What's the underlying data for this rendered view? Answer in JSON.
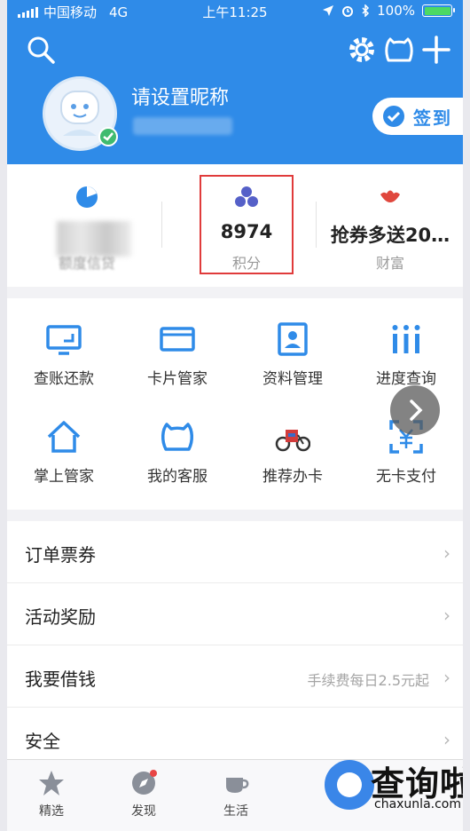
{
  "status_bar": {
    "carrier": "中国移动",
    "network": "4G",
    "time": "上午11:25",
    "battery": "100%",
    "battery_level": 1.0
  },
  "header": {
    "nickname": "请设置昵称",
    "signin_label": "签到",
    "accent": "#2f8be8"
  },
  "stats": [
    {
      "label": "额度信贷",
      "value": "",
      "icon": "pie-icon",
      "color": "#2f8be8"
    },
    {
      "label": "积分",
      "value": "8974",
      "icon": "points-icon",
      "color": "#5560c8"
    },
    {
      "label": "财富",
      "value": "抢券多送20…",
      "icon": "wealth-icon",
      "color": "#e0473d"
    }
  ],
  "services": [
    {
      "label": "查账还款",
      "icon": "bill-icon"
    },
    {
      "label": "卡片管家",
      "icon": "card-icon"
    },
    {
      "label": "资料管理",
      "icon": "profile-icon"
    },
    {
      "label": "进度查询",
      "icon": "progress-icon"
    },
    {
      "label": "掌上管家",
      "icon": "home-icon"
    },
    {
      "label": "我的客服",
      "icon": "service-icon"
    },
    {
      "label": "推荐办卡",
      "icon": "recommend-icon"
    },
    {
      "label": "无卡支付",
      "icon": "scan-pay-icon"
    }
  ],
  "menu": [
    {
      "label": "订单票券",
      "hint": ""
    },
    {
      "label": "活动奖励",
      "hint": ""
    },
    {
      "label": "我要借钱",
      "hint": "手续费每日2.5元起"
    },
    {
      "label": "安全",
      "hint": ""
    }
  ],
  "tabs": [
    {
      "label": "精选",
      "icon": "star-icon"
    },
    {
      "label": "发现",
      "icon": "compass-icon"
    },
    {
      "label": "生活",
      "icon": "cup-icon"
    }
  ],
  "watermark": {
    "title": "查询啦",
    "url": "chaxunla.com"
  }
}
